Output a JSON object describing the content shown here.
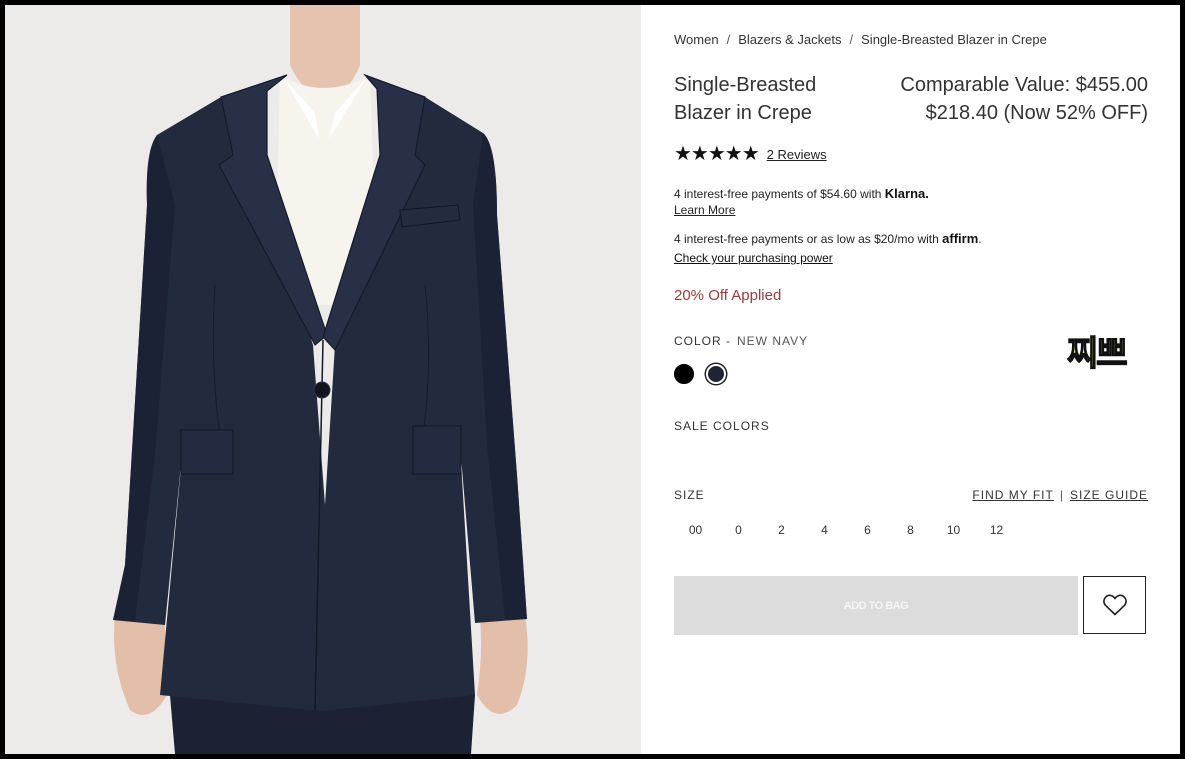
{
  "breadcrumb": {
    "items": [
      "Women",
      "Blazers & Jackets",
      "Single-Breasted Blazer in Crepe"
    ],
    "separator": "/"
  },
  "product": {
    "title": "Single-Breasted Blazer in Crepe",
    "comparable_value": "Comparable Value: $455.00",
    "sale_price": "$218.40 (Now 52% OFF)",
    "rating_stars": "★★★★★",
    "rating_value": 5,
    "reviews_link": "2 Reviews"
  },
  "payments": {
    "klarna_text": "4 interest-free payments of $54.60 with",
    "klarna_brand": "Klarna.",
    "klarna_link": "Learn More",
    "affirm_text": "4 interest-free payments or as low as $20/mo with",
    "affirm_brand": "affirm",
    "affirm_link": "Check your purchasing power"
  },
  "discount_text": "20% Off Applied",
  "color": {
    "label": "COLOR -",
    "selected": "NEW NAVY",
    "swatches": [
      {
        "name": "Black",
        "hex": "#000000"
      },
      {
        "name": "New Navy",
        "hex": "#1e2433"
      }
    ]
  },
  "sticker_text": "찌쁘",
  "sale_colors_label": "SALE COLORS",
  "size": {
    "label": "SIZE",
    "find_fit": "FIND MY FIT",
    "size_guide": "SIZE GUIDE",
    "options": [
      "00",
      "0",
      "2",
      "4",
      "6",
      "8",
      "10",
      "12"
    ]
  },
  "actions": {
    "add_to_bag": "ADD TO BAG"
  },
  "colors": {
    "discount": "#a23a3a",
    "add_to_bag_bg": "#dcdcdc",
    "blazer_navy": "#1e2433"
  }
}
